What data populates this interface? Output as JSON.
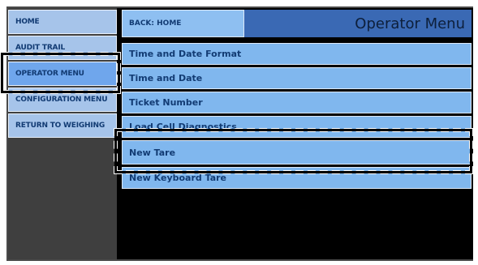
{
  "sidebar": {
    "items": [
      {
        "label": "HOME"
      },
      {
        "label": "AUDIT TRAIL"
      },
      {
        "label": "OPERATOR MENU"
      },
      {
        "label": "CONFIGURATION MENU"
      },
      {
        "label": "RETURN TO WEIGHING"
      }
    ]
  },
  "header": {
    "back_label": "BACK: HOME",
    "title": "Operator Menu"
  },
  "menu": {
    "items": [
      {
        "label": "Time and Date Format"
      },
      {
        "label": "Time and Date"
      },
      {
        "label": "Ticket Number"
      },
      {
        "label": "Load Cell Diagnostics"
      },
      {
        "label": "New Tare"
      },
      {
        "label": "New Keyboard Tare"
      }
    ]
  },
  "colors": {
    "sidebar_button": "#a6c4ea",
    "menu_item": "#80b7ee",
    "header_title_bg": "#3a69b4",
    "background": "#000000"
  }
}
